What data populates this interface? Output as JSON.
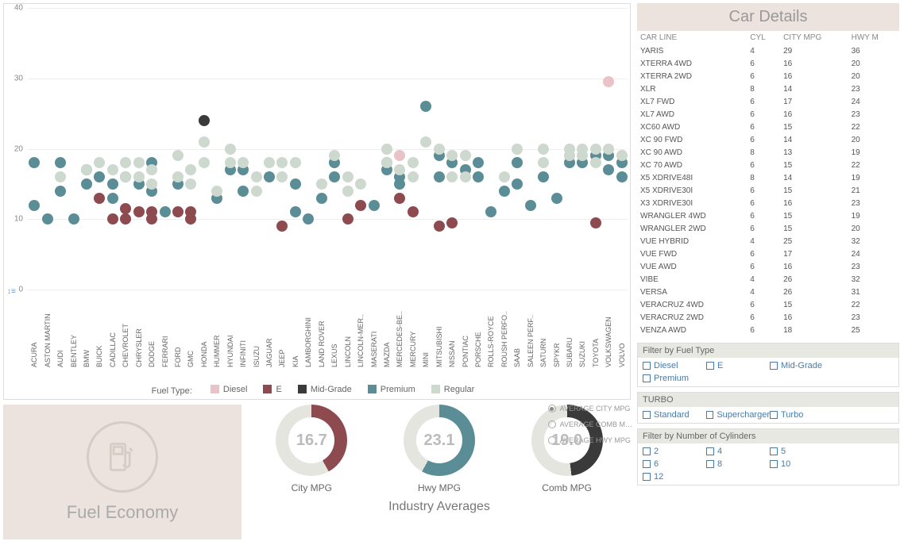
{
  "chart_data": {
    "type": "scatter",
    "title": "",
    "xlabel": "",
    "ylabel": "",
    "ylim": [
      0,
      40
    ],
    "yticks": [
      0,
      10,
      20,
      30,
      40
    ],
    "categories": [
      "ACURA",
      "ASTON MARTIN",
      "AUDI",
      "BENTLEY",
      "BMW",
      "BUICK",
      "CADILLAC",
      "CHEVROLET",
      "CHRYSLER",
      "DODGE",
      "FERRARI",
      "FORD",
      "GMC",
      "HONDA",
      "HUMMER",
      "HYUNDAI",
      "INFINITI",
      "ISUZU",
      "JAGUAR",
      "JEEP",
      "KIA",
      "LAMBORGHINI",
      "LAND ROVER",
      "LEXUS",
      "LINCOLN",
      "LINCOLN-MER..",
      "MASERATI",
      "MAZDA",
      "MERCEDES-BE..",
      "MERCURY",
      "MINI",
      "MITSUBISHI",
      "NISSAN",
      "PONTIAC",
      "PORSCHE",
      "ROLLS-ROYCE",
      "ROUSH PERFO..",
      "SAAB",
      "SALEEN PERF..",
      "SATURN",
      "SPYKR",
      "SUBARU",
      "SUZUKI",
      "TOYOTA",
      "VOLKSWAGEN",
      "VOLVO"
    ],
    "series": [
      {
        "name": "Diesel",
        "color": "#e9c3c8",
        "points": [
          [
            "MERCEDES-BE..",
            19
          ],
          [
            "VOLKSWAGEN",
            29.5
          ]
        ]
      },
      {
        "name": "E",
        "color": "#8e4b4f",
        "points": [
          [
            "BUICK",
            13
          ],
          [
            "CADILLAC",
            10
          ],
          [
            "CHEVROLET",
            11.5
          ],
          [
            "CHEVROLET",
            10
          ],
          [
            "CHRYSLER",
            11
          ],
          [
            "DODGE",
            11
          ],
          [
            "DODGE",
            10
          ],
          [
            "FORD",
            11
          ],
          [
            "GMC",
            10
          ],
          [
            "GMC",
            11
          ],
          [
            "JEEP",
            9
          ],
          [
            "LINCOLN",
            10
          ],
          [
            "LINCOLN-MER..",
            12
          ],
          [
            "MERCEDES-BE..",
            13
          ],
          [
            "MERCURY",
            11
          ],
          [
            "MITSUBISHI",
            9
          ],
          [
            "NISSAN",
            9.5
          ],
          [
            "TOYOTA",
            9.5
          ]
        ]
      },
      {
        "name": "Mid-Grade",
        "color": "#3a3a3a",
        "points": [
          [
            "HONDA",
            24
          ]
        ]
      },
      {
        "name": "Premium",
        "color": "#5a8d95",
        "points": [
          [
            "ACURA",
            18
          ],
          [
            "ACURA",
            12
          ],
          [
            "ASTON MARTIN",
            10
          ],
          [
            "AUDI",
            18
          ],
          [
            "AUDI",
            14
          ],
          [
            "BENTLEY",
            10
          ],
          [
            "BMW",
            17
          ],
          [
            "BMW",
            15
          ],
          [
            "BUICK",
            16
          ],
          [
            "CADILLAC",
            15
          ],
          [
            "CADILLAC",
            13
          ],
          [
            "CHEVROLET",
            16
          ],
          [
            "CHRYSLER",
            15
          ],
          [
            "DODGE",
            18
          ],
          [
            "DODGE",
            14
          ],
          [
            "FERRARI",
            11
          ],
          [
            "FORD",
            15
          ],
          [
            "HUMMER",
            13
          ],
          [
            "HYUNDAI",
            17
          ],
          [
            "INFINITI",
            17
          ],
          [
            "INFINITI",
            14
          ],
          [
            "JAGUAR",
            16
          ],
          [
            "KIA",
            15
          ],
          [
            "KIA",
            11
          ],
          [
            "LAMBORGHINI",
            10
          ],
          [
            "LAND ROVER",
            13
          ],
          [
            "LEXUS",
            18
          ],
          [
            "LEXUS",
            16
          ],
          [
            "MASERATI",
            12
          ],
          [
            "MAZDA",
            18
          ],
          [
            "MAZDA",
            17
          ],
          [
            "MERCEDES-BE..",
            16
          ],
          [
            "MERCEDES-BE..",
            15
          ],
          [
            "MINI",
            26
          ],
          [
            "MITSUBISHI",
            19
          ],
          [
            "MITSUBISHI",
            16
          ],
          [
            "NISSAN",
            18
          ],
          [
            "PONTIAC",
            17
          ],
          [
            "PORSCHE",
            18
          ],
          [
            "PORSCHE",
            16
          ],
          [
            "ROLLS-ROYCE",
            11
          ],
          [
            "ROUSH PERFO..",
            14
          ],
          [
            "SAAB",
            18
          ],
          [
            "SAAB",
            15
          ],
          [
            "SALEEN PERF..",
            12
          ],
          [
            "SATURN",
            16
          ],
          [
            "SPYKR",
            13
          ],
          [
            "SUBARU",
            18
          ],
          [
            "SUZUKI",
            18
          ],
          [
            "TOYOTA",
            19
          ],
          [
            "VOLKSWAGEN",
            19
          ],
          [
            "VOLKSWAGEN",
            17
          ],
          [
            "VOLVO",
            18
          ],
          [
            "VOLVO",
            16
          ]
        ]
      },
      {
        "name": "Regular",
        "color": "#cdd8ce",
        "points": [
          [
            "AUDI",
            16
          ],
          [
            "BMW",
            17
          ],
          [
            "BUICK",
            18
          ],
          [
            "CADILLAC",
            17
          ],
          [
            "CHEVROLET",
            18
          ],
          [
            "CHEVROLET",
            16
          ],
          [
            "CHRYSLER",
            18
          ],
          [
            "CHRYSLER",
            16
          ],
          [
            "DODGE",
            17
          ],
          [
            "DODGE",
            15
          ],
          [
            "FORD",
            19
          ],
          [
            "FORD",
            16
          ],
          [
            "GMC",
            17
          ],
          [
            "GMC",
            15
          ],
          [
            "HONDA",
            21
          ],
          [
            "HONDA",
            18
          ],
          [
            "HUMMER",
            14
          ],
          [
            "HYUNDAI",
            20
          ],
          [
            "HYUNDAI",
            18
          ],
          [
            "INFINITI",
            18
          ],
          [
            "ISUZU",
            16
          ],
          [
            "ISUZU",
            14
          ],
          [
            "JAGUAR",
            18
          ],
          [
            "JEEP",
            18
          ],
          [
            "JEEP",
            16
          ],
          [
            "KIA",
            18
          ],
          [
            "LAND ROVER",
            15
          ],
          [
            "LEXUS",
            19
          ],
          [
            "LINCOLN",
            16
          ],
          [
            "LINCOLN",
            14
          ],
          [
            "LINCOLN-MER..",
            15
          ],
          [
            "MAZDA",
            20
          ],
          [
            "MAZDA",
            18
          ],
          [
            "MERCEDES-BE..",
            17
          ],
          [
            "MERCURY",
            18
          ],
          [
            "MERCURY",
            16
          ],
          [
            "MINI",
            21
          ],
          [
            "MITSUBISHI",
            20
          ],
          [
            "NISSAN",
            19
          ],
          [
            "NISSAN",
            16
          ],
          [
            "PONTIAC",
            19
          ],
          [
            "PONTIAC",
            16
          ],
          [
            "ROUSH PERFO..",
            16
          ],
          [
            "SAAB",
            20
          ],
          [
            "SATURN",
            20
          ],
          [
            "SATURN",
            18
          ],
          [
            "SUBARU",
            20
          ],
          [
            "SUBARU",
            19
          ],
          [
            "SUZUKI",
            20
          ],
          [
            "SUZUKI",
            19
          ],
          [
            "TOYOTA",
            20
          ],
          [
            "TOYOTA",
            18
          ],
          [
            "VOLKSWAGEN",
            20
          ],
          [
            "VOLVO",
            19
          ]
        ]
      }
    ],
    "legend_title": "Fuel Type:"
  },
  "details": {
    "title": "Car Details",
    "columns": [
      "CAR LINE",
      "CYL",
      "CITY MPG",
      "HWY M"
    ],
    "rows": [
      [
        "YARIS",
        4,
        29,
        36
      ],
      [
        "XTERRA 4WD",
        6,
        16,
        20
      ],
      [
        "XTERRA 2WD",
        6,
        16,
        20
      ],
      [
        "XLR",
        8,
        14,
        23
      ],
      [
        "XL7 FWD",
        6,
        17,
        24
      ],
      [
        "XL7 AWD",
        6,
        16,
        23
      ],
      [
        "XC60 AWD",
        6,
        15,
        22
      ],
      [
        "XC 90 FWD",
        6,
        14,
        20
      ],
      [
        "XC 90 AWD",
        8,
        13,
        19
      ],
      [
        "XC 70 AWD",
        6,
        15,
        22
      ],
      [
        "X5 XDRIVE48I",
        8,
        14,
        19
      ],
      [
        "X5 XDRIVE30I",
        6,
        15,
        21
      ],
      [
        "X3 XDRIVE30I",
        6,
        16,
        23
      ],
      [
        "WRANGLER 4WD",
        6,
        15,
        19
      ],
      [
        "WRANGLER 2WD",
        6,
        15,
        20
      ],
      [
        "VUE HYBRID",
        4,
        25,
        32
      ],
      [
        "VUE FWD",
        6,
        17,
        24
      ],
      [
        "VUE AWD",
        6,
        16,
        23
      ],
      [
        "VIBE",
        4,
        26,
        32
      ],
      [
        "VERSA",
        4,
        26,
        31
      ],
      [
        "VERACRUZ 4WD",
        6,
        15,
        22
      ],
      [
        "VERACRUZ 2WD",
        6,
        16,
        23
      ],
      [
        "VENZA AWD",
        6,
        18,
        25
      ]
    ]
  },
  "averages": {
    "title": "Industry Averages",
    "city": {
      "label": "City MPG",
      "value": "16.7",
      "pct": 42,
      "color": "#8e4b4f"
    },
    "hwy": {
      "label": "Hwy MPG",
      "value": "23.1",
      "pct": 58,
      "color": "#5a8d95"
    },
    "comb": {
      "label": "Comb MPG",
      "value": "19.0",
      "pct": 48,
      "color": "#3a3a3a"
    },
    "radios": [
      "AVERAGE CITY MPG",
      "AVERAGE COMB M…",
      "AVERAGE HWY MPG"
    ],
    "radio_selected": 0
  },
  "fuel_card": {
    "title": "Fuel Economy"
  },
  "filters": {
    "fuel": {
      "title": "Filter by Fuel Type",
      "opts": [
        "Diesel",
        "E",
        "Mid-Grade",
        "Premium"
      ]
    },
    "turbo": {
      "title": "TURBO",
      "opts": [
        "Standard",
        "Supercharger",
        "Turbo"
      ]
    },
    "cyl": {
      "title": "Filter by Number of Cylinders",
      "opts": [
        "2",
        "4",
        "5",
        "6",
        "8",
        "10",
        "12"
      ]
    }
  }
}
